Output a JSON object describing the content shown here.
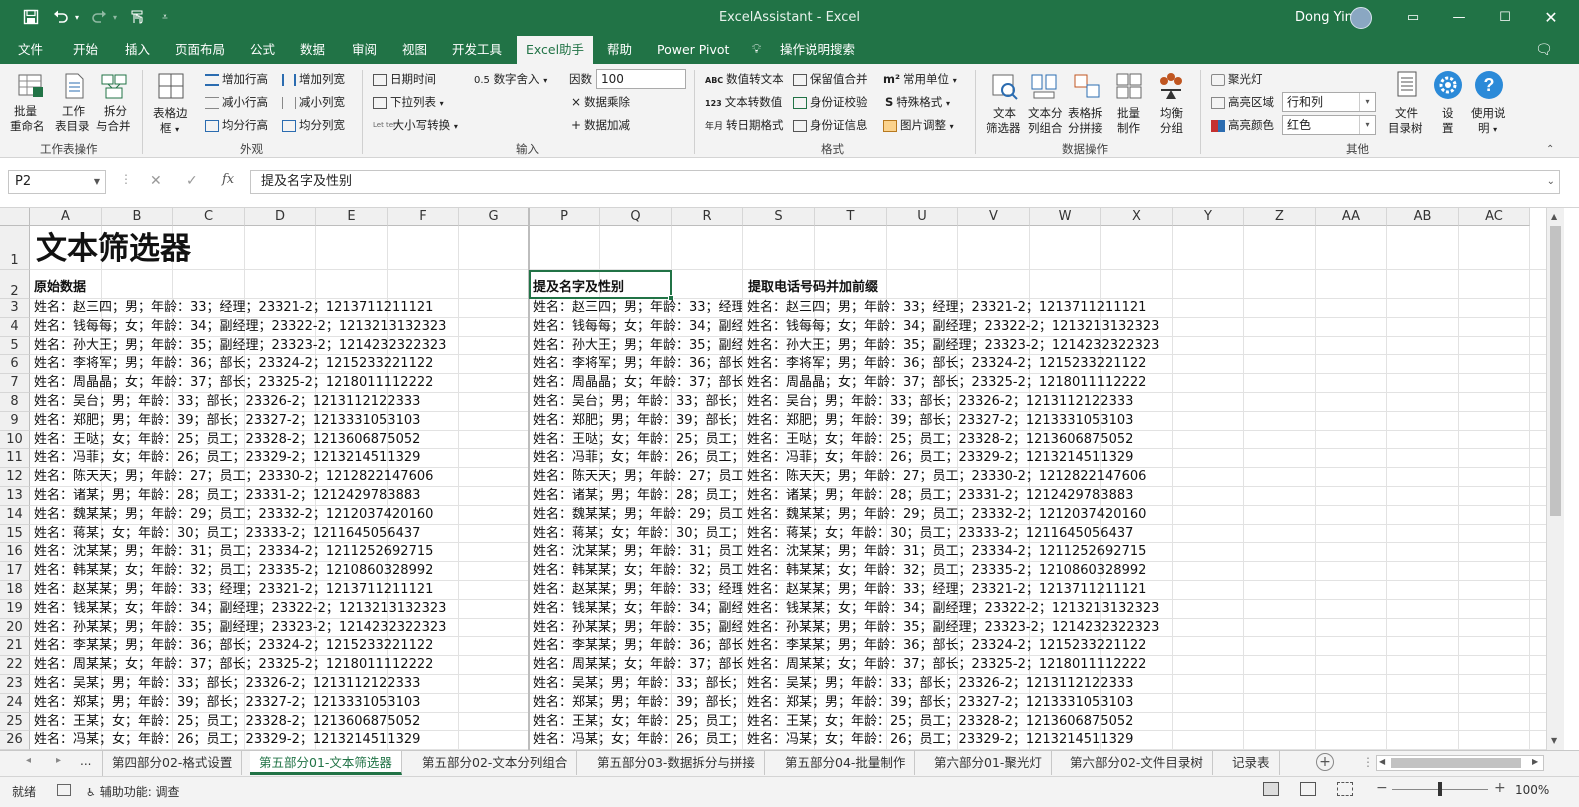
{
  "window": {
    "title": "ExcelAssistant  -  Excel",
    "user": "Dong Yin",
    "accent": "#217346"
  },
  "qat": {
    "save_icon": "save-icon",
    "undo_icon": "undo-icon",
    "redo_icon": "redo-icon",
    "touch_icon": "touch-mode-icon",
    "customize_icon": "customize-qat-icon"
  },
  "menu": {
    "items": [
      "文件",
      "开始",
      "插入",
      "页面布局",
      "公式",
      "数据",
      "审阅",
      "视图",
      "开发工具",
      "Excel助手",
      "帮助",
      "Power Pivot"
    ],
    "active": "Excel助手",
    "tell_me": "操作说明搜索"
  },
  "ribbon": {
    "g1": {
      "b1": "批量",
      "b1b": "重命名",
      "b2": "工作",
      "b2b": "表目录",
      "b3": "拆分",
      "b3b": "与合并",
      "label": "工作表操作"
    },
    "g2": {
      "b1": "表格边",
      "b1b": "框",
      "add_row_height": "增加行高",
      "add_col_width": "增加列宽",
      "reduce_row_height": "减小行高",
      "reduce_col_width": "减小列宽",
      "even_row_height": "均分行高",
      "even_col_width": "均分列宽",
      "label": "外观"
    },
    "g3": {
      "datetime": "日期时间",
      "round_prefix": "0.5",
      "round": "数字舍入",
      "factor_label": "因数",
      "factor_value": "100",
      "dropdown": "下拉列表",
      "multiply": "数据乘除",
      "case_prefix": "Let ter",
      "case": "大小写转换",
      "add": "数据加减",
      "label": "输入"
    },
    "g4": {
      "num_to_text_prefix": "ABC",
      "num_to_text": "数值转文本",
      "keep_merge": "保留值合并",
      "common_units_prefix": "m²",
      "common_units": "常用单位",
      "text_to_num_prefix": "123",
      "text_to_num": "文本转数值",
      "id_check": "身份证校验",
      "special_format_prefix": "S",
      "special_format": "特殊格式",
      "to_date_prefix": "年月",
      "to_date": "转日期格式",
      "id_info": "身份证信息",
      "image_adjust": "图片调整",
      "label": "格式"
    },
    "g5": {
      "b1": "文本",
      "b1b": "筛选器",
      "b2": "文本分",
      "b2b": "列组合",
      "b3": "表格拆",
      "b3b": "分拼接",
      "b4": "批量",
      "b4b": "制作",
      "b5": "均衡",
      "b5b": "分组",
      "label": "数据操作"
    },
    "g6": {
      "spotlight": "聚光灯",
      "hl_area_label": "高亮区域",
      "hl_area_value": "行和列",
      "hl_color_label": "高亮颜色",
      "hl_color_value": "红色",
      "b_dir": "文件",
      "b_dirb": "目录树",
      "b_set": "设",
      "b_setb": "置",
      "b_help": "使用说",
      "b_helpb": "明",
      "label": "其他"
    }
  },
  "formula": {
    "name_box": "P2",
    "cancel": "✕",
    "enter": "✓",
    "fx": "fx",
    "content": "提及名字及性别"
  },
  "grid": {
    "columns": [
      "A",
      "B",
      "C",
      "D",
      "E",
      "F",
      "G",
      "P",
      "Q",
      "R",
      "S",
      "T",
      "U",
      "V",
      "W",
      "X",
      "Y",
      "Z",
      "AA",
      "AB",
      "AC"
    ],
    "rows": [
      "1",
      "2",
      "3",
      "4",
      "5",
      "6",
      "7",
      "8",
      "9",
      "10",
      "11",
      "12",
      "13",
      "14",
      "15",
      "16",
      "17",
      "18",
      "19",
      "20",
      "21",
      "22",
      "23",
      "24",
      "25",
      "26"
    ],
    "title": "文本筛选器",
    "h_raw": "原始数据",
    "h_name": "提及名字及性别",
    "h_phone": "提取电话号码并加前缀",
    "col_a": [
      "姓名：赵三四；男；年龄：33；经理；23321-2；1213711211121",
      "姓名：钱每每；女；年龄：34；副经理；23322-2；1213213132323",
      "姓名：孙大王；男；年龄：35；副经理；23323-2；1214232322323",
      "姓名：李将军；男；年龄：36；部长；23324-2；1215233221122",
      "姓名：周晶晶；女；年龄：37；部长；23325-2；1218011112222",
      "姓名：吴台；男；年龄：33；部长；23326-2；1213112122333",
      "姓名：郑肥；男；年龄：39；部长；23327-2；1213331053103",
      "姓名：王哒；女；年龄：25；员工；23328-2；1213606875052",
      "姓名：冯菲；女；年龄：26；员工；23329-2；1213214511329",
      "姓名：陈天天；男；年龄：27；员工；23330-2；1212822147606",
      "姓名：诸某；男；年龄：28；员工；23331-2；1212429783883",
      "姓名：魏某某；男；年龄：29；员工；23332-2；1212037420160",
      "姓名：蒋某；女；年龄：30；员工；23333-2；1211645056437",
      "姓名：沈某某；男；年龄：31；员工；23334-2；1211252692715",
      "姓名：韩某某；女；年龄：32；员工；23335-2；1210860328992",
      "姓名：赵某某；男；年龄：33；经理；23321-2；1213711211121",
      "姓名：钱某某；女；年龄：34；副经理；23322-2；1213213132323",
      "姓名：孙某某；男；年龄：35；副经理；23323-2；1214232322323",
      "姓名：李某某；男；年龄：36；部长；23324-2；1215233221122",
      "姓名：周某某；女；年龄：37；部长；23325-2；1218011112222",
      "姓名：吴某；男；年龄：33；部长；23326-2；1213112122333",
      "姓名：郑某；男；年龄：39；部长；23327-2；1213331053103",
      "姓名：王某；女；年龄：25；员工；23328-2；1213606875052",
      "姓名：冯某；女；年龄：26；员工；23329-2；1213214511329"
    ]
  },
  "sheets": {
    "nav_prev": "◂",
    "nav_next": "▸",
    "more": "...",
    "tabs": [
      "第四部分02-格式设置",
      "第五部分01-文本筛选器",
      "第五部分02-文本分列组合",
      "第五部分03-数据拆分与拼接",
      "第五部分04-批量制作",
      "第六部分01-聚光灯",
      "第六部分02-文件目录树",
      "记录表"
    ],
    "active": "第五部分01-文本筛选器",
    "add": "+"
  },
  "status": {
    "ready": "就绪",
    "accessibility": "辅助功能: 调查",
    "zoom": "100%",
    "zoom_minus": "−",
    "zoom_plus": "+"
  }
}
